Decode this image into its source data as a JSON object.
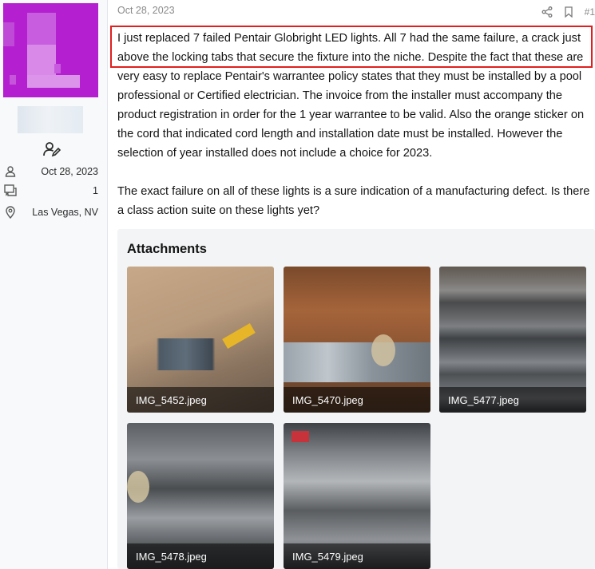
{
  "user": {
    "joined_date": "Oct 28, 2023",
    "message_count": "1",
    "location": "Las Vegas, NV",
    "avatar_color": "#b41fcf"
  },
  "post": {
    "date": "Oct 28, 2023",
    "number": "#1",
    "paragraph1": "I just replaced 7 failed Pentair Globright LED lights. All 7 had the same failure, a crack just above the locking tabs that secure the fixture into the niche. Despite the fact that these are very easy to replace Pentair's warrantee policy states that they must be installed by a pool professional or Certified electrician. The invoice from the installer must accompany the product registration in order for the 1 year warrantee to be valid. Also the orange sticker on the cord that indicated cord length and installation date must be installed. However the selection of year installed does not include a choice for 2023.",
    "paragraph2": "The exact failure on all of these lights is a sure indication of a manufacturing defect. Is there a class action suite on these lights yet?",
    "highlight_color": "#e02020"
  },
  "attachments": {
    "title": "Attachments",
    "items": [
      {
        "name": "IMG_5452.jpeg"
      },
      {
        "name": "IMG_5470.jpeg"
      },
      {
        "name": "IMG_5477.jpeg"
      },
      {
        "name": "IMG_5478.jpeg"
      },
      {
        "name": "IMG_5479.jpeg"
      }
    ]
  },
  "icons": {
    "share": "share-icon",
    "bookmark": "bookmark-icon",
    "user_joined": "user-icon",
    "messages": "messages-icon",
    "location": "location-pin-icon",
    "user_edit": "user-edit-icon"
  }
}
